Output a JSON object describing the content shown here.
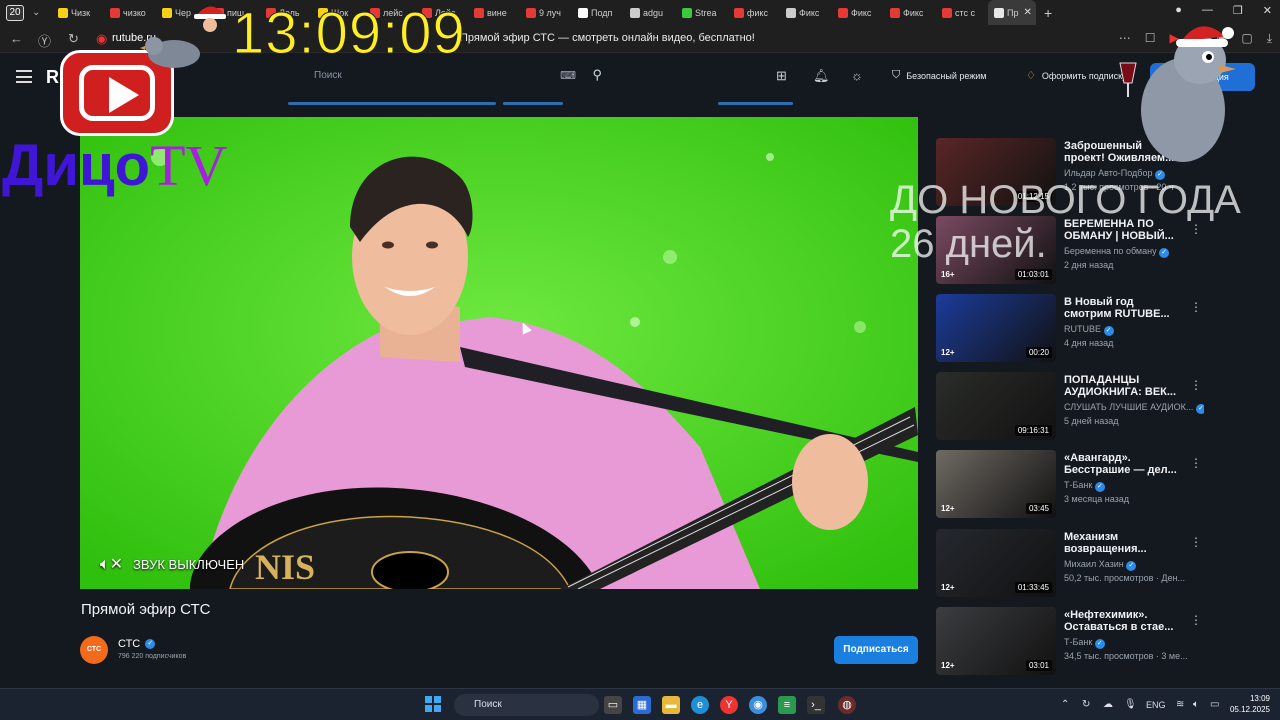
{
  "browser": {
    "tab_count": "20",
    "tabs": [
      {
        "label": "Чизк",
        "color": "#f7d117"
      },
      {
        "label": "чизкo",
        "color": "#e53935"
      },
      {
        "label": "Чер",
        "color": "#f7d117"
      },
      {
        "label": "пищ",
        "color": "#e53935"
      },
      {
        "label": "Лель",
        "color": "#e53935"
      },
      {
        "label": "Шок",
        "color": "#f7d117"
      },
      {
        "label": "лейс",
        "color": "#e53935"
      },
      {
        "label": "Лейс",
        "color": "#e53935"
      },
      {
        "label": "вине",
        "color": "#e53935"
      },
      {
        "label": "9 луч",
        "color": "#e53935"
      },
      {
        "label": "Подп",
        "color": "#ffffff"
      },
      {
        "label": "adgu",
        "color": "#cccccc"
      },
      {
        "label": "Strea",
        "color": "#3ec83e"
      },
      {
        "label": "фикс",
        "color": "#e53935"
      },
      {
        "label": "Фикс",
        "color": "#cccccc"
      },
      {
        "label": "Фикс",
        "color": "#e53935"
      },
      {
        "label": "Фикс",
        "color": "#e53935"
      },
      {
        "label": "стс с",
        "color": "#e53935"
      }
    ],
    "active_tab": "Пр",
    "url_short": "rutube.ru",
    "page_title": "Прямой эфир СТС — смотреть онлайн видео, бесплатно!"
  },
  "site": {
    "logo": "R",
    "search_placeholder": "Поиск",
    "safe_mode": "Безопасный режим",
    "subscribe_premium": "Оформить подписку",
    "register": "Регистрация"
  },
  "video": {
    "muted_label": "ЗВУК ВЫКЛЮЧЕН",
    "title": "Прямой эфир СТС",
    "channel": {
      "name": "СТС",
      "avatar_text": "СТС",
      "subscribers": "796 220 подписчиков"
    },
    "subscribe_label": "Подписаться",
    "guitar_text": "NIS"
  },
  "recommendations": [
    {
      "title": "Заброшенный проект! Оживляем...",
      "channel": "Ильдар Авто-Подбор",
      "meta": "1,2 тыс. просмотров · 20 ч",
      "duration": "01:12:15",
      "age": "",
      "thumb": "#5a2626"
    },
    {
      "title": "БЕРЕМЕННА ПО ОБМАНУ | НОВЫЙ...",
      "channel": "Беременна по обману",
      "meta": "2 дня назад",
      "duration": "01:03:01",
      "age": "16+",
      "thumb": "#7a4a62"
    },
    {
      "title": "В Новый год смотрим RUTUBE...",
      "channel": "RUTUBE",
      "meta": "4 дня назад",
      "duration": "00:20",
      "age": "12+",
      "thumb": "#1c3c9c"
    },
    {
      "title": "ПОПАДАНЦЫ АУДИОКНИГА: ВЕК...",
      "channel": "СЛУШАТЬ ЛУЧШИЕ АУДИОК...",
      "meta": "5 дней назад",
      "duration": "09:16:31",
      "age": "",
      "thumb": "#2b2d2a"
    },
    {
      "title": "«Авангард». Бесстрашие — дел...",
      "channel": "Т-Банк",
      "meta": "3 месяца назад",
      "duration": "03:45",
      "age": "12+",
      "thumb": "#6f6a63"
    },
    {
      "title": "Механизм возвращения...",
      "channel": "Михаил Хазин",
      "meta": "50,2 тыс. просмотров · Ден...",
      "duration": "01:33:45",
      "age": "12+",
      "thumb": "#25292f"
    },
    {
      "title": "«Нефтехимик». Оставаться в стае...",
      "channel": "Т-Банк",
      "meta": "34,5 тыс. просмотров · 3 ме...",
      "duration": "03:01",
      "age": "12+",
      "thumb": "#3c3d40"
    }
  ],
  "overlays": {
    "clock": "13:09:09",
    "brand_part1": "Дицо",
    "brand_part2": "TV",
    "countdown_line1": "ДО НОВОГО ГОДА",
    "countdown_line2": "26 дней."
  },
  "taskbar": {
    "search_label": "Поиск",
    "lang": "ENG",
    "time": "13:09",
    "date": "05.12.2025"
  }
}
